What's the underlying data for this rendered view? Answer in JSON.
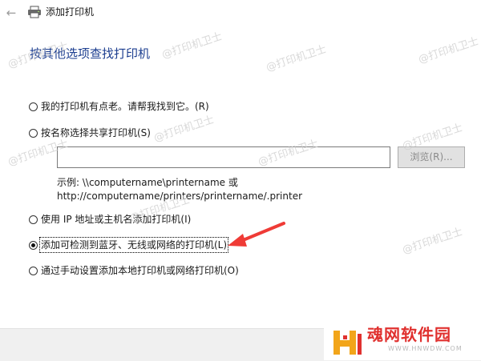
{
  "window": {
    "title": "添加打印机"
  },
  "heading": "按其他选项查找打印机",
  "options": [
    {
      "label": "我的打印机有点老。请帮我找到它。(R)",
      "checked": false
    },
    {
      "label": "按名称选择共享打印机(S)",
      "checked": false
    },
    {
      "label": "使用 IP 地址或主机名添加打印机(I)",
      "checked": false
    },
    {
      "label": "添加可检测到蓝牙、无线或网络的打印机(L)",
      "checked": true
    },
    {
      "label": "通过手动设置添加本地打印机或网络打印机(O)",
      "checked": false
    }
  ],
  "shared_printer": {
    "value": "",
    "browse_label": "浏览(R)...",
    "example_line1": "示例: \\\\computername\\printername 或",
    "example_line2": "http://computername/printers/printername/.printer"
  },
  "watermark": "@打印机卫士",
  "logo": {
    "name": "魂网软件园",
    "url": "WWW.HNWDW.COM"
  },
  "colors": {
    "heading": "#1b3d8f",
    "logo_red": "#e0312f",
    "arrow": "#ef3b36"
  }
}
